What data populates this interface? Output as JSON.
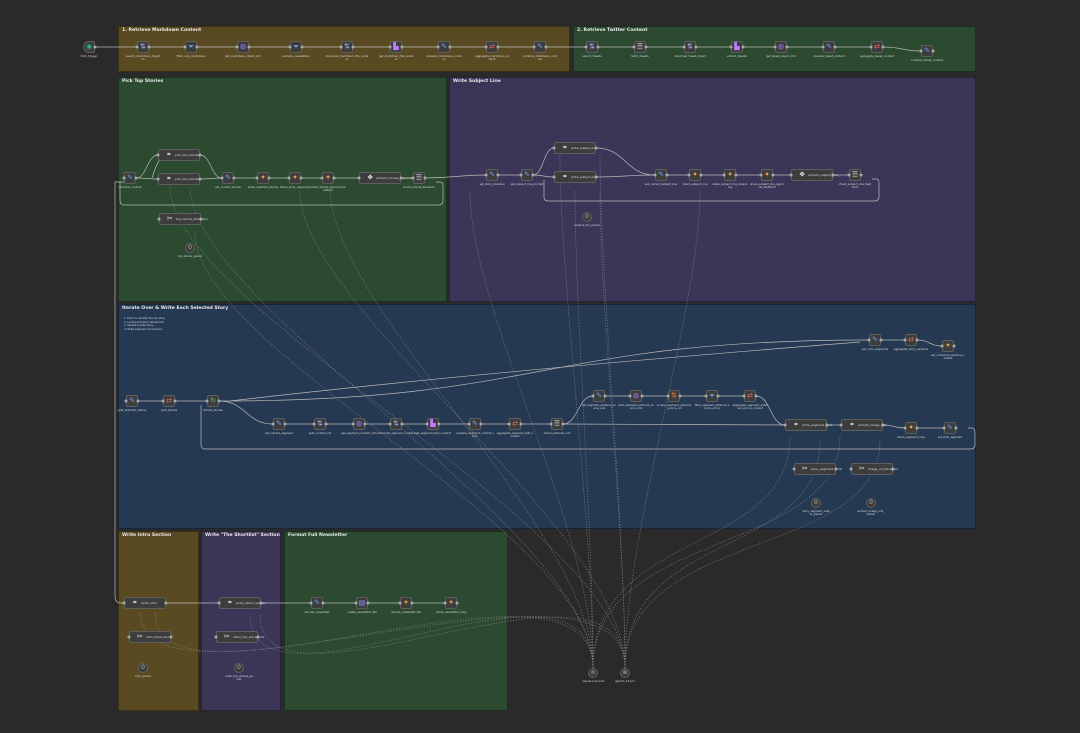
{
  "groups": [
    {
      "id": "g1",
      "title": "1. Retrieve Markdown Content",
      "color": "#5a4a22"
    },
    {
      "id": "g2",
      "title": "2. Retrieve Twitter Content",
      "color": "#2b4a30"
    },
    {
      "id": "g3",
      "title": "Pick Top Stories",
      "color": "#2b4a30"
    },
    {
      "id": "g4",
      "title": "Write Subject Line",
      "color": "#3d3558"
    },
    {
      "id": "g5",
      "title": "Iterate Over & Write Each Selected Story",
      "color": "#263952",
      "note": "1. Fetch & identify the top story\n2. Lookup full story referenced\n3. Iterate & write story\n4. Write segment conclusions"
    },
    {
      "id": "g6",
      "title": "Write Intro Section",
      "color": "#5a4a22"
    },
    {
      "id": "g7",
      "title": "Write \"The Shortlist\" Section",
      "color": "#3d3558"
    },
    {
      "id": "g8",
      "title": "Format Full Newsletter",
      "color": "#2b4a30"
    }
  ],
  "nodes": [
    {
      "id": "n0",
      "icon": "trigger-icon",
      "glyph": "◉",
      "color": "#2fb08f",
      "label": "form_trigger",
      "sub": ""
    },
    {
      "id": "n1",
      "icon": "sort-icon",
      "glyph": "⇅",
      "color": "#b0b8ff",
      "label": "search_markdown_object",
      "sub": "s3"
    },
    {
      "id": "n2",
      "icon": "filter-icon",
      "glyph": "⏷",
      "color": "#6fa8ff",
      "label": "filter_only_markdown",
      "sub": ""
    },
    {
      "id": "n3",
      "icon": "globe-icon",
      "glyph": "◍",
      "color": "#9a7cff",
      "label": "get_markdown_object_info",
      "sub": ""
    },
    {
      "id": "n4",
      "icon": "filter-icon",
      "glyph": "⏷",
      "color": "#6fa8ff",
      "label": "exclude_newsletters",
      "sub": ""
    },
    {
      "id": "n5",
      "icon": "sort-icon",
      "glyph": "⇅",
      "color": "#b0b8ff",
      "label": "download_markdown_file_conte",
      "sub": "nt"
    },
    {
      "id": "n6",
      "icon": "chart-icon",
      "glyph": "▙",
      "color": "#c07cff",
      "label": "get_markdown_file_conte",
      "sub": "nt"
    },
    {
      "id": "n7",
      "icon": "pencil-icon",
      "glyph": "✎",
      "color": "#6f9dff",
      "label": "prepare_markdown_conte",
      "sub": "nt"
    },
    {
      "id": "n8",
      "icon": "route-icon",
      "glyph": "⇄",
      "color": "#e06060",
      "label": "aggregate_markdown_co",
      "sub": "ntent"
    },
    {
      "id": "n9",
      "icon": "pencil-icon",
      "glyph": "✎",
      "color": "#6f9dff",
      "label": "combine_markdown_cont",
      "sub": "ent"
    },
    {
      "id": "n10",
      "icon": "sort-icon",
      "glyph": "⇅",
      "color": "#b0b8ff",
      "label": "search_tweets",
      "sub": ""
    },
    {
      "id": "n11",
      "icon": "merge-icon",
      "glyph": "☰",
      "color": "#d8d8d8",
      "label": "fetch_tweets",
      "sub": ""
    },
    {
      "id": "n12",
      "icon": "sort-icon",
      "glyph": "⇅",
      "color": "#b0b8ff",
      "label": "download_tweet_object",
      "sub": ""
    },
    {
      "id": "n13",
      "icon": "chart-icon",
      "glyph": "▙",
      "color": "#c07cff",
      "label": "extract_tweets",
      "sub": ""
    },
    {
      "id": "n14",
      "icon": "globe-icon",
      "glyph": "◍",
      "color": "#9a7cff",
      "label": "get_tweet_object_info",
      "sub": ""
    },
    {
      "id": "n15",
      "icon": "pencil-icon",
      "glyph": "✎",
      "color": "#6f9dff",
      "label": "prepare_tweet_content",
      "sub": ""
    },
    {
      "id": "n16",
      "icon": "route-icon",
      "glyph": "⇄",
      "color": "#e06060",
      "label": "aggregate_tweet_content",
      "sub": ""
    },
    {
      "id": "n17",
      "icon": "pencil-icon",
      "glyph": "✎",
      "color": "#6f9dff",
      "label": "combine_tweet_content",
      "sub": ""
    },
    {
      "id": "n18",
      "icon": "pencil-icon",
      "glyph": "✎",
      "color": "#6f9dff",
      "label": "combine_content",
      "sub": ""
    },
    {
      "id": "n19",
      "icon": "link-icon",
      "glyph": "⚭",
      "color": "#e0e0e0",
      "label": "pick_top_stories",
      "sub": ""
    },
    {
      "id": "n20",
      "icon": "link-icon",
      "glyph": "⚭",
      "color": "#e0e0e0",
      "label": "pick_top_stories",
      "sub": ""
    },
    {
      "id": "n21",
      "icon": "pencil-icon",
      "glyph": "✎",
      "color": "#6f9dff",
      "label": "set_current_stories",
      "sub": ""
    },
    {
      "id": "n22",
      "icon": "slack-icon",
      "glyph": "✦",
      "color": "#e8a23c",
      "label": "share_selected_stories",
      "sub": ""
    },
    {
      "id": "n23",
      "icon": "slack-icon",
      "glyph": "✦",
      "color": "#e8a23c",
      "label": "share_story_reasoning",
      "sub": ""
    },
    {
      "id": "n24",
      "icon": "slack-icon",
      "glyph": "✦",
      "color": "#e8a23c",
      "label": "share_stories_approval_fe",
      "sub": "edback"
    },
    {
      "id": "n25",
      "icon": "check-icon",
      "glyph": "❖",
      "color": "#e0e0e0",
      "label": "extract_stories_approval",
      "sub": "_feedback"
    },
    {
      "id": "n26",
      "icon": "merge-icon",
      "glyph": "☰",
      "color": "#d8d8d8",
      "label": "check_stories_feedback",
      "sub": ""
    },
    {
      "id": "n27",
      "icon": "pencil-icon",
      "glyph": "✎",
      "color": "#6f9dff",
      "label": "set_story_domains",
      "sub": ""
    },
    {
      "id": "n28",
      "icon": "pencil-icon",
      "glyph": "✎",
      "color": "#6f9dff",
      "label": "set_subject_line_prompt",
      "sub": ""
    },
    {
      "id": "n29",
      "icon": "link-icon",
      "glyph": "⚭",
      "color": "#e0e0e0",
      "label": "write_subject_line",
      "sub": ""
    },
    {
      "id": "n30",
      "icon": "link-icon",
      "glyph": "⚭",
      "color": "#e0e0e0",
      "label": "write_subject_line",
      "sub": ""
    },
    {
      "id": "n31",
      "icon": "pencil-icon",
      "glyph": "✎",
      "color": "#6f9dff",
      "label": "set_current_subject_line",
      "sub": ""
    },
    {
      "id": "n32",
      "icon": "slack-icon",
      "glyph": "✦",
      "color": "#e8a23c",
      "label": "share_subject_line",
      "sub": ""
    },
    {
      "id": "n33",
      "icon": "slack-icon",
      "glyph": "✦",
      "color": "#e8a23c",
      "label": "share_subject_line_reason",
      "sub": "ing"
    },
    {
      "id": "n34",
      "icon": "slack-icon",
      "glyph": "✦",
      "color": "#e8a23c",
      "label": "share_subject_line_appro",
      "sub": "val_feedback"
    },
    {
      "id": "n35",
      "icon": "check-icon",
      "glyph": "❖",
      "color": "#e0e0e0",
      "label": "extract_subject_line_",
      "sub": "feedback"
    },
    {
      "id": "n36",
      "icon": "merge-icon",
      "glyph": "☰",
      "color": "#d8d8d8",
      "label": "check_subject_line_feed",
      "sub": "back"
    },
    {
      "id": "n37",
      "icon": "tool-icon",
      "glyph": "✂",
      "color": "#e0e0e0",
      "label": "top_stories_think_too",
      "sub": "l"
    },
    {
      "id": "n38",
      "icon": "code-icon",
      "glyph": "⟨⟩",
      "color": "#e0e0e0",
      "label": "top_stories_parser",
      "sub": ""
    },
    {
      "id": "n39",
      "icon": "code-icon",
      "glyph": "⟨⟩",
      "color": "#e0e0e0",
      "label": "subject_line_parser",
      "sub": ""
    },
    {
      "id": "n40",
      "icon": "pencil-icon",
      "glyph": "✎",
      "color": "#6f9dff",
      "label": "set_intro_segments",
      "sub": ""
    },
    {
      "id": "n41",
      "icon": "route-icon",
      "glyph": "⇄",
      "color": "#e06060",
      "label": "aggregate_story_sections",
      "sub": ""
    },
    {
      "id": "n42",
      "icon": "slack-icon",
      "glyph": "✦",
      "color": "#e8a23c",
      "label": "set_combined_sections_c",
      "sub": "ontent"
    },
    {
      "id": "n43",
      "icon": "pencil-icon",
      "glyph": "✎",
      "color": "#6f9dff",
      "label": "split_selected_stories",
      "sub": ""
    },
    {
      "id": "n44",
      "icon": "route-icon",
      "glyph": "⇄",
      "color": "#e06060",
      "label": "split_stories",
      "sub": ""
    },
    {
      "id": "n45",
      "icon": "loop-icon",
      "glyph": "↻",
      "color": "#4ec96f",
      "label": "iterate_stories",
      "sub": ""
    },
    {
      "id": "n46",
      "icon": "pencil-icon",
      "glyph": "✎",
      "color": "#6f9dff",
      "label": "set_current_segment",
      "sub": ""
    },
    {
      "id": "n47",
      "icon": "sort-icon",
      "glyph": "⇅",
      "color": "#b0b8ff",
      "label": "split_content_ids",
      "sub": ""
    },
    {
      "id": "n48",
      "icon": "globe-icon",
      "glyph": "◍",
      "color": "#9a7cff",
      "label": "get_segment_content_info",
      "sub": ""
    },
    {
      "id": "n49",
      "icon": "sort-icon",
      "glyph": "⇅",
      "color": "#b0b8ff",
      "label": "download_segment_content",
      "sub": ""
    },
    {
      "id": "n50",
      "icon": "chart-icon",
      "glyph": "▙",
      "color": "#c07cff",
      "label": "get_segment_text_content",
      "sub": ""
    },
    {
      "id": "n51",
      "icon": "pencil-icon",
      "glyph": "✎",
      "color": "#6f9dff",
      "label": "prepare_segment_content_i",
      "sub": "tem"
    },
    {
      "id": "n52",
      "icon": "route-icon",
      "glyph": "⇄",
      "color": "#e06060",
      "label": "aggregate_segment_text_c",
      "sub": "ontent"
    },
    {
      "id": "n53",
      "icon": "merge-icon",
      "glyph": "☰",
      "color": "#d8d8d8",
      "label": "check_external_urls",
      "sub": ""
    },
    {
      "id": "n54",
      "icon": "pencil-icon",
      "glyph": "✎",
      "color": "#6f9dff",
      "label": "set_segment_external_so",
      "sub": "urce_urls"
    },
    {
      "id": "n55",
      "icon": "globe-icon",
      "glyph": "◍",
      "color": "#9a7cff",
      "label": "split_segment_external_so",
      "sub": "urce_urls"
    },
    {
      "id": "n56",
      "icon": "sort-icon",
      "glyph": "⇅",
      "color": "#e8823c",
      "label": "scrape_segment_external",
      "sub": "_source_url"
    },
    {
      "id": "n57",
      "icon": "filter-icon",
      "glyph": "⏷",
      "color": "#6fa8ff",
      "label": "filter_segment_external_s",
      "sub": "ource_errors"
    },
    {
      "id": "n58",
      "icon": "route-icon",
      "glyph": "⇄",
      "color": "#e06060",
      "label": "aggregate_segment_exter",
      "sub": "nal_source_content"
    },
    {
      "id": "n59",
      "icon": "link-icon",
      "glyph": "⚭",
      "color": "#e0e0e0",
      "label": "write_segment_cont",
      "sub": "ent"
    },
    {
      "id": "n60",
      "icon": "link-icon",
      "glyph": "⚭",
      "color": "#e0e0e0",
      "label": "extract_image_urls",
      "sub": ""
    },
    {
      "id": "n61",
      "icon": "slack-icon",
      "glyph": "✦",
      "color": "#e8a23c",
      "label": "share_segment_msg",
      "sub": ""
    },
    {
      "id": "n62",
      "icon": "pencil-icon",
      "glyph": "✎",
      "color": "#6f9dff",
      "label": "set_final_segment",
      "sub": ""
    },
    {
      "id": "n63",
      "icon": "tool-icon",
      "glyph": "✂",
      "color": "#e0e0e0",
      "label": "story_segment_think",
      "sub": "_tool"
    },
    {
      "id": "n64",
      "icon": "tool-icon",
      "glyph": "✂",
      "color": "#e0e0e0",
      "label": "image_url_think_too",
      "sub": "l"
    },
    {
      "id": "n65",
      "icon": "code-icon",
      "glyph": "⟨⟩",
      "color": "#e0e0e0",
      "label": "story_segment_outp",
      "sub": "ut_parser"
    },
    {
      "id": "n66",
      "icon": "code-icon",
      "glyph": "⟨⟩",
      "color": "#e0e0e0",
      "label": "extract_image_urls_",
      "sub": "parser"
    },
    {
      "id": "n67",
      "icon": "link-icon",
      "glyph": "⚭",
      "color": "#e0e0e0",
      "label": "write_intro",
      "sub": ""
    },
    {
      "id": "n68",
      "icon": "tool-icon",
      "glyph": "✂",
      "color": "#e0e0e0",
      "label": "intro_think_tool",
      "sub": ""
    },
    {
      "id": "n69",
      "icon": "code-icon",
      "glyph": "⟨⟩",
      "color": "#e0e0e0",
      "label": "intro_parser",
      "sub": ""
    },
    {
      "id": "n70",
      "icon": "link-icon",
      "glyph": "⚭",
      "color": "#e0e0e0",
      "label": "write_other_tops_se",
      "sub": "ction"
    },
    {
      "id": "n71",
      "icon": "tool-icon",
      "glyph": "✂",
      "color": "#e0e0e0",
      "label": "other_top_stories_thi",
      "sub": "nk_tool"
    },
    {
      "id": "n72",
      "icon": "code-icon",
      "glyph": "⟨⟩",
      "color": "#e0e0e0",
      "label": "other_top_stories_pa",
      "sub": "rser"
    },
    {
      "id": "n73",
      "icon": "pencil-icon",
      "glyph": "✎",
      "color": "#6f9dff",
      "label": "set_full_newsletter",
      "sub": ""
    },
    {
      "id": "n74",
      "icon": "file-icon",
      "glyph": "▤",
      "color": "#8aa0ff",
      "label": "create_newsletter_file",
      "sub": ""
    },
    {
      "id": "n75",
      "icon": "slack-icon",
      "glyph": "✦",
      "color": "#e8a23c",
      "label": "upload_newsletter_file",
      "sub": ""
    },
    {
      "id": "n76",
      "icon": "slack-icon",
      "glyph": "✦",
      "color": "#e8a23c",
      "label": "share_newsletter_msg",
      "sub": ""
    },
    {
      "id": "n77",
      "icon": "model-icon",
      "glyph": "⍝",
      "color": "#d8d8d8",
      "label": "claude-4-sonnet",
      "sub": ""
    },
    {
      "id": "n78",
      "icon": "model-icon",
      "glyph": "◎",
      "color": "#d8d8d8",
      "label": "gemini-2.5-pro",
      "sub": ""
    }
  ]
}
